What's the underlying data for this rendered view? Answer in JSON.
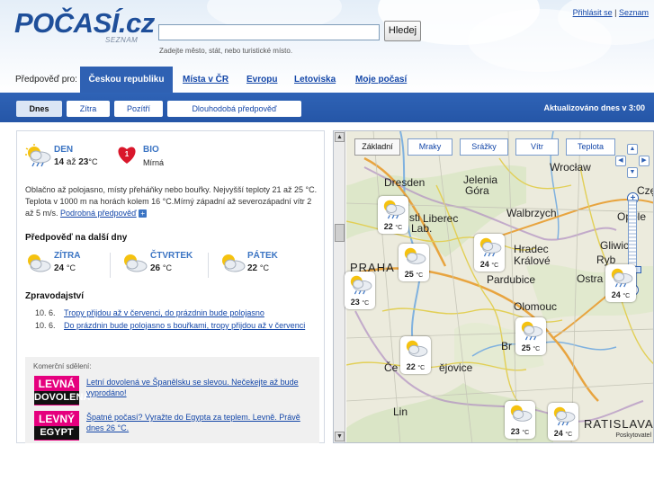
{
  "header": {
    "logo": "POČASÍ.cz",
    "logo_sub": "SEZNAM",
    "search_placeholder": "",
    "search_button": "Hledej",
    "search_hint": "Zadejte město, stát, nebo turistické místo.",
    "login_link": "Přihlásit se",
    "separator": "|",
    "seznam_link": "Seznam"
  },
  "nav": {
    "label": "Předpověď pro:",
    "active": "Českou republiku",
    "items": [
      "Místa v ČR",
      "Evropu",
      "Letoviska",
      "Moje počasí"
    ]
  },
  "subnav": {
    "buttons": [
      "Dnes",
      "Zítra",
      "Pozítří",
      "Dlouhodobá předpověď"
    ],
    "active": "Dnes",
    "updated": "Aktualizováno dnes v 3:00"
  },
  "today": {
    "day_label": "DEN",
    "temp_from": "14",
    "temp_conj": "až",
    "temp_to": "23",
    "unit": "°C",
    "bio_label": "BIO",
    "bio_value": "Mírná",
    "bio_level": "1",
    "description": "Oblačno až polojasno, místy přeháňky nebo bouřky. Nejvyšší teploty 21 až 25 °C. Teplota v 1000 m na horách kolem 16 °C.Mírný západní až severozápadní vítr 2 až 5 m/s.",
    "detail_link": "Podrobná předpověď",
    "detail_plus": "+"
  },
  "next_days": {
    "title": "Předpověď na další dny",
    "days": [
      {
        "name": "ZÍTRA",
        "temp": "24",
        "unit": "°C"
      },
      {
        "name": "ČTVRTEK",
        "temp": "26",
        "unit": "°C"
      },
      {
        "name": "PÁTEK",
        "temp": "22",
        "unit": "°C"
      }
    ]
  },
  "news": {
    "title": "Zpravodajství",
    "items": [
      {
        "date": "10. 6.",
        "text": "Tropy přijdou až v červenci, do prázdnin bude polojasno"
      },
      {
        "date": "10. 6.",
        "text": "Do prázdnin bude polojasno s bouřkami, tropy přijdou až v červenci"
      }
    ]
  },
  "ads": {
    "label": "Komerční sdělení:",
    "items": [
      {
        "img_top": "LEVNÁ",
        "img_bottom": "DOVOLENÁ",
        "text": "Letní dovolená ve Španělsku se slevou. Nečekejte až bude vyprodáno!"
      },
      {
        "img_top": "LEVNÝ",
        "img_bottom": "EGYPT",
        "text": "Špatné počasí? Vyražte do Egypta za teplem. Levně. Právě dnes 26 °C."
      }
    ]
  },
  "map": {
    "tabs": [
      "Základní",
      "Mraky",
      "Srážky",
      "Vítr",
      "Teplota"
    ],
    "active_tab": "Základní",
    "cities": [
      "Dresden",
      "Wrocław",
      "Jelenia",
      "Góra",
      "Liberec",
      "Walbrzych",
      "Opole",
      "Gliwice",
      "Ryb",
      "Ostra",
      "PRAHA",
      "Hradec",
      "Králové",
      "Pardubice",
      "Olomouc",
      "Br",
      "Če",
      "ějovice",
      "Lin",
      "RATISLAVA",
      "Czę",
      "sti",
      "Lab."
    ],
    "temps": [
      {
        "value": "22",
        "unit": "°C"
      },
      {
        "value": "24",
        "unit": "°C"
      },
      {
        "value": "25",
        "unit": "°C"
      },
      {
        "value": "23",
        "unit": "°C"
      },
      {
        "value": "25",
        "unit": "°C"
      },
      {
        "value": "22",
        "unit": "°C"
      },
      {
        "value": "23",
        "unit": "°C"
      },
      {
        "value": "24",
        "unit": "°C"
      },
      {
        "value": "24",
        "unit": "°C"
      }
    ],
    "credit": "Poskytovatel"
  },
  "colors": {
    "brand_blue": "#2f61b3",
    "link": "#1346a8",
    "day_label": "#3b74c3",
    "ad_pink": "#e5007e"
  }
}
